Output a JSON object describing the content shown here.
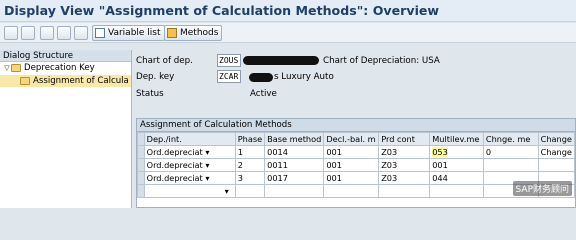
{
  "window": {
    "title": "Display View \"Assignment of Calculation Methods\": Overview"
  },
  "toolbar": {
    "variable_list": "Variable list",
    "methods": "Methods"
  },
  "dialog_structure": {
    "header": "Dialog Structure",
    "items": [
      {
        "label": "Deprecation Key"
      },
      {
        "label": "Assignment of Calcula"
      }
    ]
  },
  "form": {
    "chart_label": "Chart of dep.",
    "chart_value": "ZOUS",
    "chart_desc": "Chart of Depreciation: USA",
    "depkey_label": "Dep. key",
    "depkey_value": "ZCAR",
    "depkey_desc": "s Luxury Auto",
    "status_label": "Status",
    "status_value": "Active"
  },
  "table": {
    "title": "Assignment of Calculation Methods",
    "columns": [
      "Dep./int.",
      "Phase",
      "Base method",
      "Decl.-bal. m",
      "Prd cont",
      "Multilev.me",
      "Chnge. me",
      "Change"
    ],
    "rows": [
      [
        "Ord.depreciat",
        "1",
        "0014",
        "001",
        "Z03",
        "053",
        "0",
        "Change"
      ],
      [
        "Ord.depreciat",
        "2",
        "0011",
        "001",
        "Z03",
        "001",
        "",
        ""
      ],
      [
        "Ord.depreciat",
        "3",
        "0017",
        "001",
        "Z03",
        "044",
        "",
        ""
      ]
    ]
  },
  "watermark": "SAP财务顾问"
}
